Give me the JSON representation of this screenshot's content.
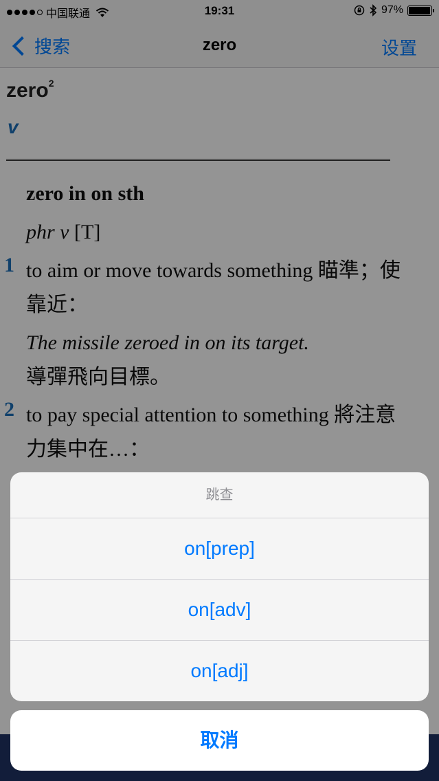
{
  "status_bar": {
    "carrier": "中国联通",
    "time": "19:31",
    "battery": "97%",
    "battery_level": 0.97,
    "icons": [
      "signal-dots",
      "wifi-icon",
      "orientation-lock-icon",
      "bluetooth-icon",
      "battery-icon"
    ]
  },
  "nav": {
    "back_label": "搜索",
    "title": "zero",
    "settings_label": "设置"
  },
  "entry": {
    "headword": "zero",
    "homograph": "2",
    "pos": "v",
    "phrase": "zero in on sth",
    "phrase_pos": "phr v",
    "phrase_grammar": "[T]",
    "senses": [
      {
        "number": "1",
        "definition": "to aim or move towards something 瞄準；使靠近：",
        "example_en": "The missile zeroed in on its target.",
        "example_zh": "導彈飛向目標。"
      },
      {
        "number": "2",
        "definition": "to pay special attention to something 將注意力集中在…："
      }
    ]
  },
  "action_sheet": {
    "title": "跳查",
    "options": [
      "on[prep]",
      "on[adv]",
      "on[adj]"
    ],
    "cancel_label": "取消"
  },
  "colors": {
    "accent": "#007aff",
    "dictionary_blue": "#1c6fb8",
    "bottom_bar": "#1f3264"
  }
}
